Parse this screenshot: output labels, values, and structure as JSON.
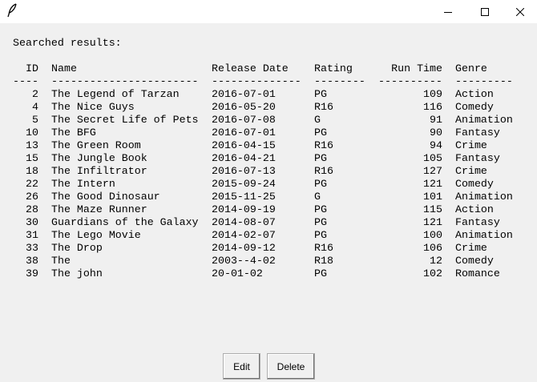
{
  "window": {
    "app_icon": "feather-icon",
    "controls": [
      "minimize-icon",
      "maximize-icon",
      "close-icon"
    ]
  },
  "heading": "Searched results:",
  "table": {
    "headers": {
      "id": "ID",
      "name": "Name",
      "release_date": "Release Date",
      "rating": "Rating",
      "run_time": "Run Time",
      "genre": "Genre"
    },
    "separators": {
      "id": "----",
      "name": "-----------------------",
      "release_date": "--------------",
      "rating": "--------",
      "run_time": "----------",
      "genre": "---------"
    },
    "rows": [
      {
        "id": "2",
        "name": "The Legend of Tarzan",
        "release_date": "2016-07-01",
        "rating": "PG",
        "run_time": "109",
        "genre": "Action"
      },
      {
        "id": "4",
        "name": "The Nice Guys",
        "release_date": "2016-05-20",
        "rating": "R16",
        "run_time": "116",
        "genre": "Comedy"
      },
      {
        "id": "5",
        "name": "The Secret Life of Pets",
        "release_date": "2016-07-08",
        "rating": "G",
        "run_time": "91",
        "genre": "Animation"
      },
      {
        "id": "10",
        "name": "The BFG",
        "release_date": "2016-07-01",
        "rating": "PG",
        "run_time": "90",
        "genre": "Fantasy"
      },
      {
        "id": "13",
        "name": "The Green Room",
        "release_date": "2016-04-15",
        "rating": "R16",
        "run_time": "94",
        "genre": "Crime"
      },
      {
        "id": "15",
        "name": "The Jungle Book",
        "release_date": "2016-04-21",
        "rating": "PG",
        "run_time": "105",
        "genre": "Fantasy"
      },
      {
        "id": "18",
        "name": "The Infiltrator",
        "release_date": "2016-07-13",
        "rating": "R16",
        "run_time": "127",
        "genre": "Crime"
      },
      {
        "id": "22",
        "name": "The Intern",
        "release_date": "2015-09-24",
        "rating": "PG",
        "run_time": "121",
        "genre": "Comedy"
      },
      {
        "id": "26",
        "name": "The Good Dinosaur",
        "release_date": "2015-11-25",
        "rating": "G",
        "run_time": "101",
        "genre": "Animation"
      },
      {
        "id": "28",
        "name": "The Maze Runner",
        "release_date": "2014-09-19",
        "rating": "PG",
        "run_time": "115",
        "genre": "Action"
      },
      {
        "id": "30",
        "name": "Guardians of the Galaxy",
        "release_date": "2014-08-07",
        "rating": "PG",
        "run_time": "121",
        "genre": "Fantasy"
      },
      {
        "id": "31",
        "name": "The Lego Movie",
        "release_date": "2014-02-07",
        "rating": "PG",
        "run_time": "100",
        "genre": "Animation"
      },
      {
        "id": "33",
        "name": "The Drop",
        "release_date": "2014-09-12",
        "rating": "R16",
        "run_time": "106",
        "genre": "Crime"
      },
      {
        "id": "38",
        "name": "The",
        "release_date": "2003--4-02",
        "rating": "R18",
        "run_time": "12",
        "genre": "Comedy"
      },
      {
        "id": "39",
        "name": "The john",
        "release_date": "20-01-02",
        "rating": "PG",
        "run_time": "102",
        "genre": "Romance"
      }
    ]
  },
  "buttons": {
    "edit": "Edit",
    "delete": "Delete"
  }
}
